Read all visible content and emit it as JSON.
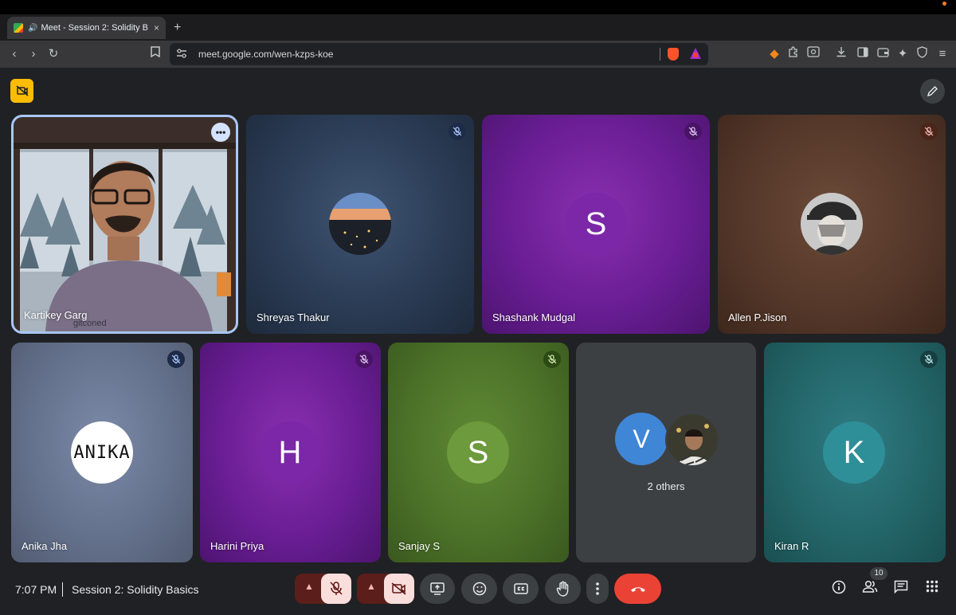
{
  "browser": {
    "tab_title": "Meet - Session 2: Solidity B",
    "tab_close": "×",
    "new_tab": "+",
    "url": "meet.google.com/wen-kzps-koe"
  },
  "participants": [
    {
      "name": "Kartikey Garg",
      "shirt_text": "gitconed"
    },
    {
      "name": "Shreyas Thakur"
    },
    {
      "name": "Shashank Mudgal",
      "initial": "S",
      "avatar_color": "#7b27a8"
    },
    {
      "name": "Allen P.Jison"
    },
    {
      "name": "Anika Jha",
      "avatar_text": "ANIKA"
    },
    {
      "name": "Harini Priya",
      "initial": "H",
      "avatar_color": "#7b27a8"
    },
    {
      "name": "Sanjay S",
      "initial": "S",
      "avatar_color": "#6d9a3c"
    },
    {
      "name": "2 others",
      "initial": "V",
      "avatar_color": "#3f86d6"
    },
    {
      "name": "Kiran R",
      "initial": "K",
      "avatar_color": "#2f8f98"
    }
  ],
  "meeting": {
    "time": "7:07 PM",
    "title": "Session 2: Solidity Basics",
    "participant_count": "10"
  },
  "colors": {
    "end_call": "#ea4335",
    "muted_bg": "#f9dedc",
    "active_border": "#a8c7fa",
    "record_icon_bg": "#fbbc04"
  }
}
